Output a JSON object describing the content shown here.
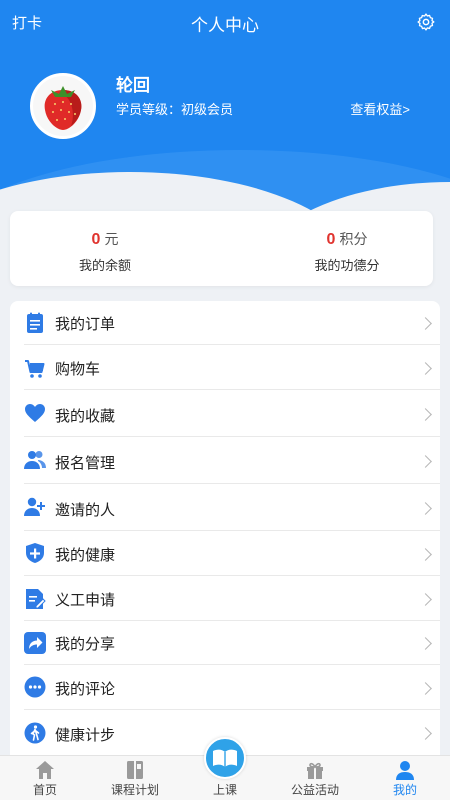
{
  "topbar": {
    "checkin": "打卡",
    "title": "个人中心",
    "settings_icon": "gear-icon"
  },
  "profile": {
    "name": "轮回",
    "level": "学员等级：初级会员",
    "rights_link": "查看权益>"
  },
  "stats": [
    {
      "value": "0",
      "unit": "元",
      "label": "我的余额"
    },
    {
      "value": "0",
      "unit": "积分",
      "label": "我的功德分"
    }
  ],
  "menu": [
    {
      "label": "我的订单",
      "icon": "order-icon"
    },
    {
      "label": "购物车",
      "icon": "cart-icon"
    },
    {
      "label": "我的收藏",
      "icon": "heart-icon"
    },
    {
      "label": "报名管理",
      "icon": "users-icon"
    },
    {
      "label": "邀请的人",
      "icon": "add-user-icon"
    },
    {
      "label": "我的健康",
      "icon": "health-shield-icon"
    },
    {
      "label": "义工申请",
      "icon": "application-form-icon"
    },
    {
      "label": "我的分享",
      "icon": "share-icon"
    },
    {
      "label": "我的评论",
      "icon": "comment-icon"
    },
    {
      "label": "健康计步",
      "icon": "walking-icon"
    }
  ],
  "tabbar": [
    {
      "label": "首页",
      "icon": "home-icon"
    },
    {
      "label": "课程计划",
      "icon": "book-plan-icon"
    },
    {
      "label": "上课",
      "icon": "open-book-icon"
    },
    {
      "label": "公益活动",
      "icon": "gift-icon"
    },
    {
      "label": "我的",
      "icon": "user-icon"
    }
  ],
  "colors": {
    "brand": "#1f86f0",
    "value": "#e0332e",
    "icon": "#2f7be5"
  }
}
